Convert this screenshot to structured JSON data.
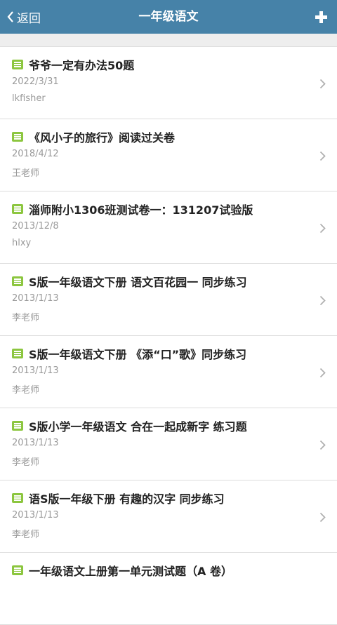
{
  "nav": {
    "back_label": "返回",
    "title": "一年级语文",
    "add_icon": "plus-icon",
    "bg_color": "#4682a8"
  },
  "items": [
    {
      "title": "爷爷一定有办法50题",
      "date": "2022/3/31",
      "author": "lkfisher"
    },
    {
      "title": "《风小子的旅行》阅读过关卷",
      "date": "2018/4/12",
      "author": "王老师"
    },
    {
      "title": "淄师附小1306班测试卷一：131207试验版",
      "date": "2013/12/8",
      "author": "hlxy"
    },
    {
      "title": "S版一年级语文下册 语文百花园一 同步练习",
      "date": "2013/1/13",
      "author": "李老师"
    },
    {
      "title": "S版一年级语文下册 《添“口”歌》同步练习",
      "date": "2013/1/13",
      "author": "李老师"
    },
    {
      "title": "S版小学一年级语文 合在一起成新字 练习题",
      "date": "2013/1/13",
      "author": "李老师"
    },
    {
      "title": "语S版一年级下册 有趣的汉字 同步练习",
      "date": "2013/1/13",
      "author": "李老师"
    },
    {
      "title": "一年级语文上册第一单元测试题（A 卷）",
      "date": "",
      "author": ""
    }
  ],
  "icons": {
    "item_icon": "document-icon",
    "item_arrow": "chevron-right-icon",
    "icon_color": "#8cc63f"
  }
}
